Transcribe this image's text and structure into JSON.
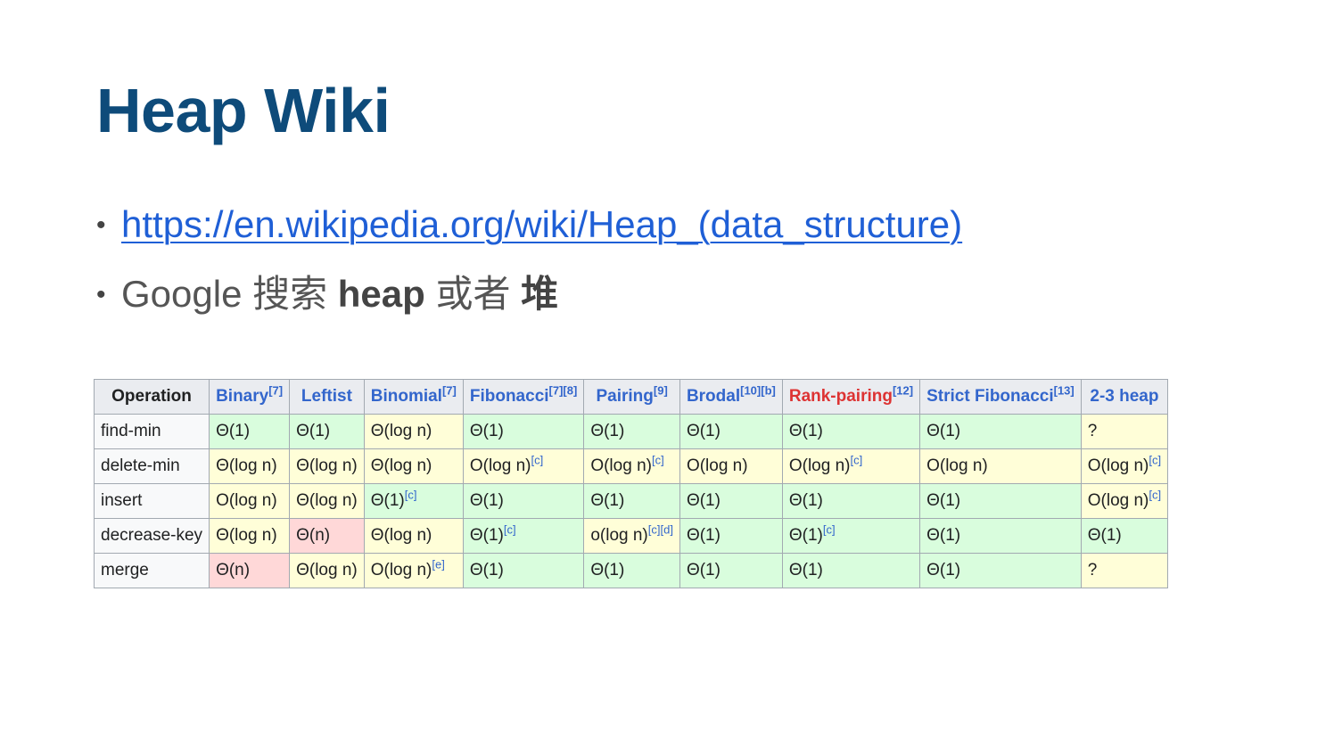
{
  "slide": {
    "title": "Heap Wiki",
    "bullets": {
      "link_text": "https://en.wikipedia.org/wiki/Heap_(data_structure)",
      "google_prefix": "Google 搜索 ",
      "google_term1": "heap",
      "google_mid": " 或者 ",
      "google_term2": "堆"
    }
  },
  "table": {
    "headers": [
      {
        "label": "Operation",
        "ref": ""
      },
      {
        "label": "Binary",
        "ref": "[7]"
      },
      {
        "label": "Leftist",
        "ref": ""
      },
      {
        "label": "Binomial",
        "ref": "[7]"
      },
      {
        "label": "Fibonacci",
        "ref": "[7][8]"
      },
      {
        "label": "Pairing",
        "ref": "[9]"
      },
      {
        "label": "Brodal",
        "ref": "[10][b]"
      },
      {
        "label": "Rank-pairing",
        "ref": "[12]"
      },
      {
        "label": "Strict Fibonacci",
        "ref": "[13]"
      },
      {
        "label": "2-3 heap",
        "ref": ""
      }
    ],
    "rows": [
      {
        "op": "find-min",
        "cells": [
          {
            "v": "Θ(1)",
            "ref": "",
            "status": "good"
          },
          {
            "v": "Θ(1)",
            "ref": "",
            "status": "good"
          },
          {
            "v": "Θ(log n)",
            "ref": "",
            "status": "mid"
          },
          {
            "v": "Θ(1)",
            "ref": "",
            "status": "good"
          },
          {
            "v": "Θ(1)",
            "ref": "",
            "status": "good"
          },
          {
            "v": "Θ(1)",
            "ref": "",
            "status": "good"
          },
          {
            "v": "Θ(1)",
            "ref": "",
            "status": "good"
          },
          {
            "v": "Θ(1)",
            "ref": "",
            "status": "good"
          },
          {
            "v": "?",
            "ref": "",
            "status": "unk"
          }
        ]
      },
      {
        "op": "delete-min",
        "cells": [
          {
            "v": "Θ(log n)",
            "ref": "",
            "status": "mid"
          },
          {
            "v": "Θ(log n)",
            "ref": "",
            "status": "mid"
          },
          {
            "v": "Θ(log n)",
            "ref": "",
            "status": "mid"
          },
          {
            "v": "O(log n)",
            "ref": "[c]",
            "status": "mid"
          },
          {
            "v": "O(log n)",
            "ref": "[c]",
            "status": "mid"
          },
          {
            "v": "O(log n)",
            "ref": "",
            "status": "mid"
          },
          {
            "v": "O(log n)",
            "ref": "[c]",
            "status": "mid"
          },
          {
            "v": "O(log n)",
            "ref": "",
            "status": "mid"
          },
          {
            "v": "O(log n)",
            "ref": "[c]",
            "status": "mid"
          }
        ]
      },
      {
        "op": "insert",
        "cells": [
          {
            "v": "O(log n)",
            "ref": "",
            "status": "mid"
          },
          {
            "v": "Θ(log n)",
            "ref": "",
            "status": "mid"
          },
          {
            "v": "Θ(1)",
            "ref": "[c]",
            "status": "good"
          },
          {
            "v": "Θ(1)",
            "ref": "",
            "status": "good"
          },
          {
            "v": "Θ(1)",
            "ref": "",
            "status": "good"
          },
          {
            "v": "Θ(1)",
            "ref": "",
            "status": "good"
          },
          {
            "v": "Θ(1)",
            "ref": "",
            "status": "good"
          },
          {
            "v": "Θ(1)",
            "ref": "",
            "status": "good"
          },
          {
            "v": "O(log n)",
            "ref": "[c]",
            "status": "mid"
          }
        ]
      },
      {
        "op": "decrease-key",
        "cells": [
          {
            "v": "Θ(log n)",
            "ref": "",
            "status": "mid"
          },
          {
            "v": "Θ(n)",
            "ref": "",
            "status": "bad"
          },
          {
            "v": "Θ(log n)",
            "ref": "",
            "status": "mid"
          },
          {
            "v": "Θ(1)",
            "ref": "[c]",
            "status": "good"
          },
          {
            "v": "o(log n)",
            "ref": "[c][d]",
            "status": "mid"
          },
          {
            "v": "Θ(1)",
            "ref": "",
            "status": "good"
          },
          {
            "v": "Θ(1)",
            "ref": "[c]",
            "status": "good"
          },
          {
            "v": "Θ(1)",
            "ref": "",
            "status": "good"
          },
          {
            "v": "Θ(1)",
            "ref": "",
            "status": "good"
          }
        ]
      },
      {
        "op": "merge",
        "cells": [
          {
            "v": "Θ(n)",
            "ref": "",
            "status": "bad"
          },
          {
            "v": "Θ(log n)",
            "ref": "",
            "status": "mid"
          },
          {
            "v": "O(log n)",
            "ref": "[e]",
            "status": "mid"
          },
          {
            "v": "Θ(1)",
            "ref": "",
            "status": "good"
          },
          {
            "v": "Θ(1)",
            "ref": "",
            "status": "good"
          },
          {
            "v": "Θ(1)",
            "ref": "",
            "status": "good"
          },
          {
            "v": "Θ(1)",
            "ref": "",
            "status": "good"
          },
          {
            "v": "Θ(1)",
            "ref": "",
            "status": "good"
          },
          {
            "v": "?",
            "ref": "",
            "status": "unk"
          }
        ]
      }
    ]
  },
  "colors": {
    "title": "#0e4b7a",
    "link": "#1f5fd6",
    "good": "#d9fddd",
    "mid": "#fffed8",
    "bad": "#ffd8d8",
    "header_bg": "#eaecf0",
    "header_link": "#3366cc",
    "header_redlink": "#d33"
  }
}
